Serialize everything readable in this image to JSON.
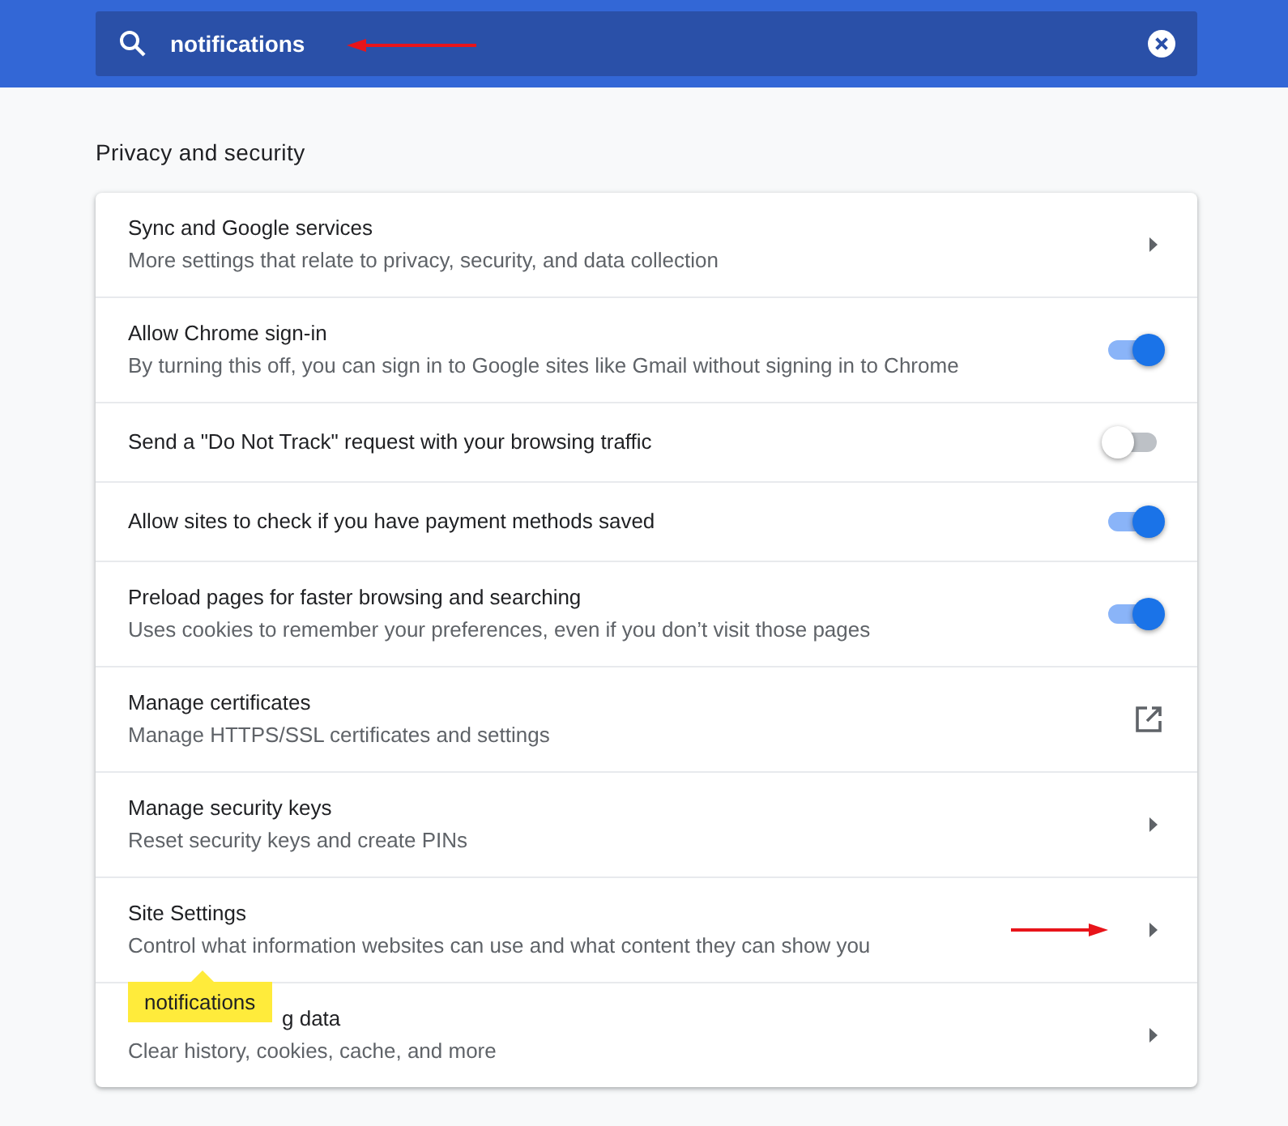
{
  "search": {
    "value": "notifications"
  },
  "section": {
    "title": "Privacy and security"
  },
  "rows": [
    {
      "kind": "arrow",
      "title": "Sync and Google services",
      "subtitle": "More settings that relate to privacy, security, and data collection"
    },
    {
      "kind": "toggle",
      "title": "Allow Chrome sign-in",
      "subtitle": "By turning this off, you can sign in to Google sites like Gmail without signing in to Chrome",
      "on": true
    },
    {
      "kind": "toggle",
      "title": "Send a \"Do Not Track\" request with your browsing traffic",
      "on": false
    },
    {
      "kind": "toggle",
      "title": "Allow sites to check if you have payment methods saved",
      "on": true
    },
    {
      "kind": "toggle",
      "title": "Preload pages for faster browsing and searching",
      "subtitle": "Uses cookies to remember your preferences, even if you don’t visit those pages",
      "on": true
    },
    {
      "kind": "external",
      "title": "Manage certificates",
      "subtitle": "Manage HTTPS/SSL certificates and settings"
    },
    {
      "kind": "arrow",
      "title": "Manage security keys",
      "subtitle": "Reset security keys and create PINs"
    },
    {
      "kind": "arrow",
      "title": "Site Settings",
      "subtitle": "Control what information websites can use and what content they can show you",
      "highlight": "notifications"
    },
    {
      "kind": "arrow",
      "title": "g data",
      "subtitle": "Clear history, cookies, cache, and more",
      "covered": true
    }
  ]
}
